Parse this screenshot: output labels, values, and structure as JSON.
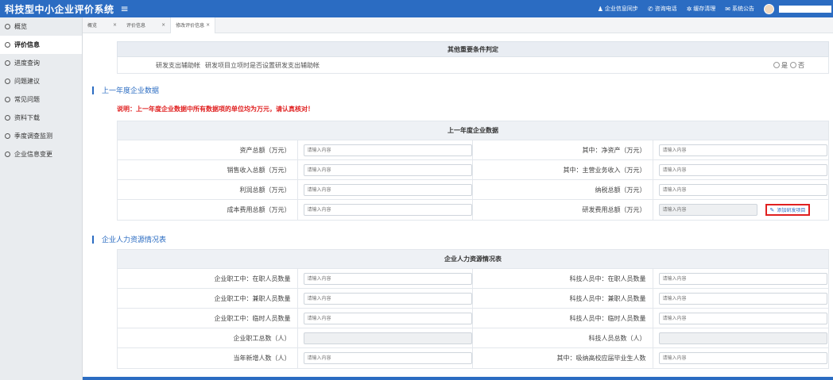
{
  "header": {
    "title": "科技型中小企业评价系统",
    "menu_icon": "≡",
    "links": [
      {
        "icon": "user-icon",
        "label": "企业信息同步"
      },
      {
        "icon": "phone-icon",
        "label": "咨询电话"
      },
      {
        "icon": "gear-icon",
        "label": "缓存清理"
      },
      {
        "icon": "notice-icon",
        "label": "系统公告"
      }
    ]
  },
  "sidebar": {
    "items": [
      {
        "label": "概览"
      },
      {
        "label": "评价信息"
      },
      {
        "label": "进度查询"
      },
      {
        "label": "问题建议"
      },
      {
        "label": "常见问题"
      },
      {
        "label": "资料下载"
      },
      {
        "label": "季度调查监测"
      },
      {
        "label": "企业信息变更"
      }
    ],
    "active_index": 1
  },
  "tabs": [
    {
      "label": "概览"
    },
    {
      "label": "评价信息"
    },
    {
      "label": "修改评价信息"
    }
  ],
  "conditions": {
    "header": "其他重要条件判定",
    "row_label": "研发支出辅助帐",
    "row_text": "研发项目立项时是否设置研发支出辅助帐",
    "yes": "是",
    "no": "否"
  },
  "last_year": {
    "section_title": "上一年度企业数据",
    "note": "说明：上一年度企业数据中所有数据项的单位均为万元，请认真核对！",
    "table_header": "上一年度企业数据",
    "rows": [
      {
        "l1": "资产总额（万元）",
        "l2": "其中：净资产（万元）"
      },
      {
        "l1": "销售收入总额（万元）",
        "l2": "其中：主营业务收入（万元）"
      },
      {
        "l1": "利润总额（万元）",
        "l2": "纳税总额（万元）"
      },
      {
        "l1": "成本费用总额（万元）",
        "l2": "研发费用总额（万元）"
      }
    ],
    "add_project_button": "添加研发项目"
  },
  "hr": {
    "section_title": "企业人力资源情况表",
    "table_header": "企业人力资源情况表",
    "rows": [
      {
        "l1": "企业职工中：在职人员数量",
        "l2": "科技人员中：在职人员数量"
      },
      {
        "l1": "企业职工中：兼职人员数量",
        "l2": "科技人员中：兼职人员数量"
      },
      {
        "l1": "企业职工中：临时人员数量",
        "l2": "科技人员中：临时人员数量"
      },
      {
        "l1": "企业职工总数（人）",
        "l2": "科技人员总数（人）"
      },
      {
        "l1": "当年新增人数（人）",
        "l2": "其中：吸纳高校应届毕业生人数"
      }
    ]
  },
  "placeholder": "请输入内容"
}
